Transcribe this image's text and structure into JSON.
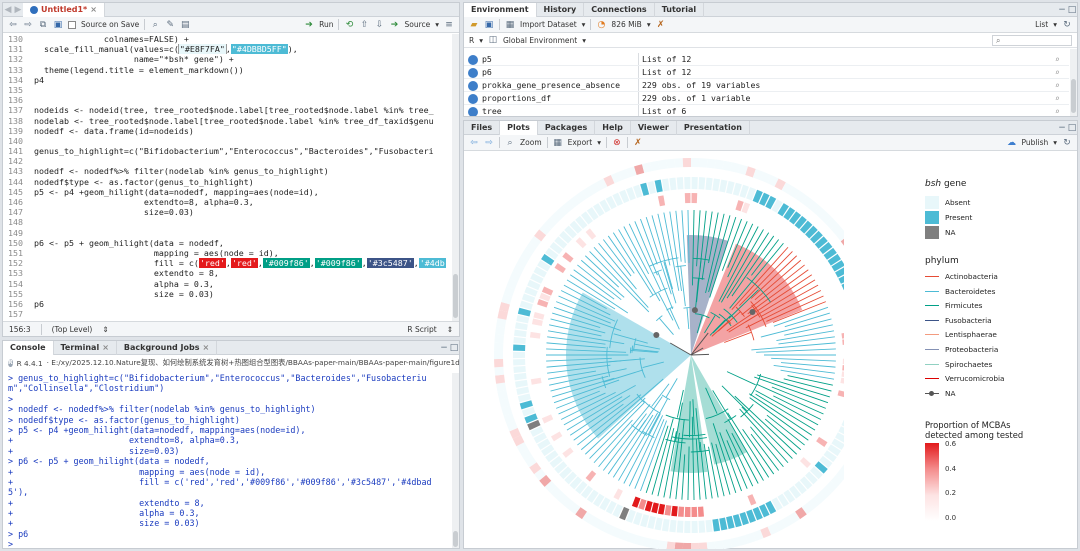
{
  "editor": {
    "tab_label": "Untitled1*",
    "source_on_save": "Source on Save",
    "run_label": "Run",
    "source_label": "Source",
    "status_position": "156:3",
    "status_scope": "(Top Level)",
    "status_type": "R Script",
    "lines": [
      {
        "num": "130",
        "segs": [
          {
            "t": "              colnames=FALSE) +"
          }
        ]
      },
      {
        "num": "131",
        "segs": [
          {
            "t": "  scale_fill_manual(values=c("
          },
          {
            "t": "\"#E8F7FA\"",
            "bg": "#e8f7fa",
            "fg": "#222",
            "bd": "1"
          },
          {
            "t": ","
          },
          {
            "t": "\"#4DBBD5FF\"",
            "bg": "#4dbbd5"
          },
          {
            "t": "),"
          }
        ]
      },
      {
        "num": "132",
        "segs": [
          {
            "t": "                    name=\"*bsh* gene\") +"
          }
        ]
      },
      {
        "num": "133",
        "segs": [
          {
            "t": "  theme(legend.title = element_markdown())"
          }
        ]
      },
      {
        "num": "134",
        "segs": [
          {
            "t": "p4"
          }
        ]
      },
      {
        "num": "135",
        "segs": [
          {
            "t": ""
          }
        ]
      },
      {
        "num": "136",
        "segs": [
          {
            "t": ""
          }
        ]
      },
      {
        "num": "137",
        "segs": [
          {
            "t": "nodeids <- nodeid(tree, tree_rooted$node.label[tree_rooted$node.label %in% tree_"
          }
        ]
      },
      {
        "num": "138",
        "segs": [
          {
            "t": "nodelab <- tree_rooted$node.label[tree_rooted$node.label %in% tree_df_taxid$genu"
          }
        ]
      },
      {
        "num": "139",
        "segs": [
          {
            "t": "nodedf <- data.frame(id=nodeids)"
          }
        ]
      },
      {
        "num": "140",
        "segs": [
          {
            "t": ""
          }
        ]
      },
      {
        "num": "141",
        "segs": [
          {
            "t": "genus_to_highlight=c(\"Bifidobacterium\",\"Enterococcus\",\"Bacteroides\",\"Fusobacteri"
          }
        ]
      },
      {
        "num": "142",
        "segs": [
          {
            "t": ""
          }
        ]
      },
      {
        "num": "143",
        "segs": [
          {
            "t": "nodedf <- nodedf%>% filter(nodelab %in% genus_to_highlight)"
          }
        ]
      },
      {
        "num": "144",
        "segs": [
          {
            "t": "nodedf$type <- as.factor(genus_to_highlight)"
          }
        ]
      },
      {
        "num": "145",
        "segs": [
          {
            "t": "p5 <- p4 +geom_hilight(data=nodedf, mapping=aes(node=id),"
          }
        ]
      },
      {
        "num": "146",
        "segs": [
          {
            "t": "                      extendto=8, alpha=0.3,"
          }
        ]
      },
      {
        "num": "147",
        "segs": [
          {
            "t": "                      size=0.03)"
          }
        ]
      },
      {
        "num": "148",
        "segs": [
          {
            "t": ""
          }
        ]
      },
      {
        "num": "149",
        "segs": [
          {
            "t": ""
          }
        ]
      },
      {
        "num": "150",
        "segs": [
          {
            "t": "p6 <- p5 + geom_hilight(data = nodedf,"
          }
        ]
      },
      {
        "num": "151",
        "segs": [
          {
            "t": "                        mapping = aes(node = id),"
          }
        ]
      },
      {
        "num": "152",
        "segs": [
          {
            "t": "                        fill = c("
          },
          {
            "t": "'red'",
            "bg": "#e41a1c"
          },
          {
            "t": ","
          },
          {
            "t": "'red'",
            "bg": "#e41a1c"
          },
          {
            "t": ","
          },
          {
            "t": "'#009f86'",
            "bg": "#009f86"
          },
          {
            "t": ","
          },
          {
            "t": "'#009f86'",
            "bg": "#009f86"
          },
          {
            "t": ","
          },
          {
            "t": "'#3c5487'",
            "bg": "#3c5487"
          },
          {
            "t": ","
          },
          {
            "t": "'#4db",
            "bg": "#4dbbd5"
          }
        ]
      },
      {
        "num": "153",
        "segs": [
          {
            "t": "                        extendto = 8,"
          }
        ]
      },
      {
        "num": "154",
        "segs": [
          {
            "t": "                        alpha = 0.3,"
          }
        ]
      },
      {
        "num": "155",
        "segs": [
          {
            "t": "                        size = 0.03)"
          }
        ]
      },
      {
        "num": "156",
        "segs": [
          {
            "t": "p6"
          }
        ]
      },
      {
        "num": "157",
        "segs": [
          {
            "t": ""
          }
        ]
      }
    ]
  },
  "console": {
    "tabs": [
      "Console",
      "Terminal",
      "Background Jobs"
    ],
    "r_version": "R 4.4.1",
    "path": "· E:/xy/2025.12.10.Nature复现、如何绘制系统发育树+热图组合型图表/BBAAs-paper-main/BBAAs-paper-main/figure1d/",
    "lines": [
      "> genus_to_highlight=c(\"Bifidobacterium\",\"Enterococcus\",\"Bacteroides\",\"Fusobacteriu",
      "m\",\"Collinsella\",\"Clostridium\")",
      ">",
      "> nodedf <- nodedf%>% filter(nodelab %in% genus_to_highlight)",
      "> nodedf$type <- as.factor(genus_to_highlight)",
      "> p5 <- p4 +geom_hilight(data=nodedf, mapping=aes(node=id),",
      "+                       extendto=8, alpha=0.3,",
      "+                       size=0.03)",
      "> p6 <- p5 + geom_hilight(data = nodedf,",
      "+                         mapping = aes(node = id),",
      "+                         fill = c('red','red','#009f86','#009f86','#3c5487','#4dbad",
      "5'),",
      "+                         extendto = 8,",
      "+                         alpha = 0.3,",
      "+                         size = 0.03)",
      "> p6",
      ">"
    ]
  },
  "environment": {
    "tabs": [
      "Environment",
      "History",
      "Connections",
      "Tutorial"
    ],
    "import_dataset": "Import Dataset",
    "memory": "826 MiB",
    "list_view": "List",
    "r_selector": "R",
    "scope": "Global Environment",
    "rows": [
      {
        "name": "p5",
        "value": "List of  12"
      },
      {
        "name": "p6",
        "value": "List of  12"
      },
      {
        "name": "prokka_gene_presence_absence",
        "value": "229 obs. of 19 variables"
      },
      {
        "name": "proportions_df",
        "value": "229 obs. of 1 variable"
      },
      {
        "name": "tree",
        "value": "List of  6"
      }
    ]
  },
  "files": {
    "tabs": [
      "Files",
      "Plots",
      "Packages",
      "Help",
      "Viewer",
      "Presentation"
    ],
    "zoom": "Zoom",
    "export": "Export",
    "publish": "Publish"
  },
  "plot": {
    "bsh_title_italic": "bsh",
    "bsh_title_rest": " gene",
    "bsh_items": [
      {
        "label": "Absent",
        "color": "#e8f7fa"
      },
      {
        "label": "Present",
        "color": "#4dbbd5"
      },
      {
        "label": "NA",
        "color": "#7f7f7f"
      }
    ],
    "phylum_title": "phylum",
    "phylum_items": [
      {
        "label": "Actinobacteria",
        "color": "#e64b35"
      },
      {
        "label": "Bacteroidetes",
        "color": "#4dbbd5"
      },
      {
        "label": "Firmicutes",
        "color": "#00a087"
      },
      {
        "label": "Fusobacteria",
        "color": "#3c5488"
      },
      {
        "label": "Lentisphaerae",
        "color": "#f39b7f"
      },
      {
        "label": "Proteobacteria",
        "color": "#8491b4"
      },
      {
        "label": "Spirochaetes",
        "color": "#91d1c2"
      },
      {
        "label": "Verrucomicrobia",
        "color": "#dc0000"
      },
      {
        "label": "NA",
        "color": "#555555"
      }
    ],
    "prop_title_1": "Proportion of MCBAs",
    "prop_title_2": "detected among tested",
    "prop_ticks": [
      "0.6",
      "0.4",
      "0.2",
      "0.0"
    ]
  }
}
